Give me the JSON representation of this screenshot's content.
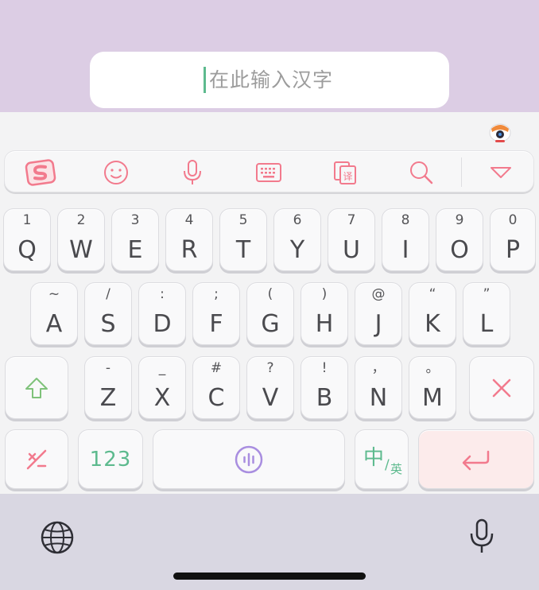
{
  "input": {
    "placeholder": "在此输入汉字"
  },
  "toolbar": {
    "items": [
      "sogou-logo",
      "emoji",
      "voice",
      "keyboard",
      "clipboard",
      "search",
      "collapse"
    ]
  },
  "rows": [
    [
      {
        "sub": "1",
        "main": "Q"
      },
      {
        "sub": "2",
        "main": "W"
      },
      {
        "sub": "3",
        "main": "E"
      },
      {
        "sub": "4",
        "main": "R"
      },
      {
        "sub": "5",
        "main": "T"
      },
      {
        "sub": "6",
        "main": "Y"
      },
      {
        "sub": "7",
        "main": "U"
      },
      {
        "sub": "8",
        "main": "I"
      },
      {
        "sub": "9",
        "main": "O"
      },
      {
        "sub": "0",
        "main": "P"
      }
    ],
    [
      {
        "sub": "~",
        "main": "A"
      },
      {
        "sub": "/",
        "main": "S"
      },
      {
        "sub": ":",
        "main": "D"
      },
      {
        "sub": ";",
        "main": "F"
      },
      {
        "sub": "(",
        "main": "G"
      },
      {
        "sub": ")",
        "main": "H"
      },
      {
        "sub": "@",
        "main": "J"
      },
      {
        "sub": "“",
        "main": "K"
      },
      {
        "sub": "”",
        "main": "L"
      }
    ],
    [
      {
        "sub": "-",
        "main": "Z"
      },
      {
        "sub": "_",
        "main": "X"
      },
      {
        "sub": "#",
        "main": "C"
      },
      {
        "sub": "?",
        "main": "V"
      },
      {
        "sub": "!",
        "main": "B"
      },
      {
        "sub": "，",
        "main": "N"
      },
      {
        "sub": "。",
        "main": "M"
      }
    ]
  ],
  "bottom_row": {
    "num_label": "123",
    "lang_main": "中",
    "lang_sep": "/",
    "lang_sub": "英"
  },
  "colors": {
    "accent_pink": "#f27a8d",
    "accent_green": "#5dba8e",
    "accent_purple": "#a98ee0",
    "shift_green": "#7fc27a"
  }
}
